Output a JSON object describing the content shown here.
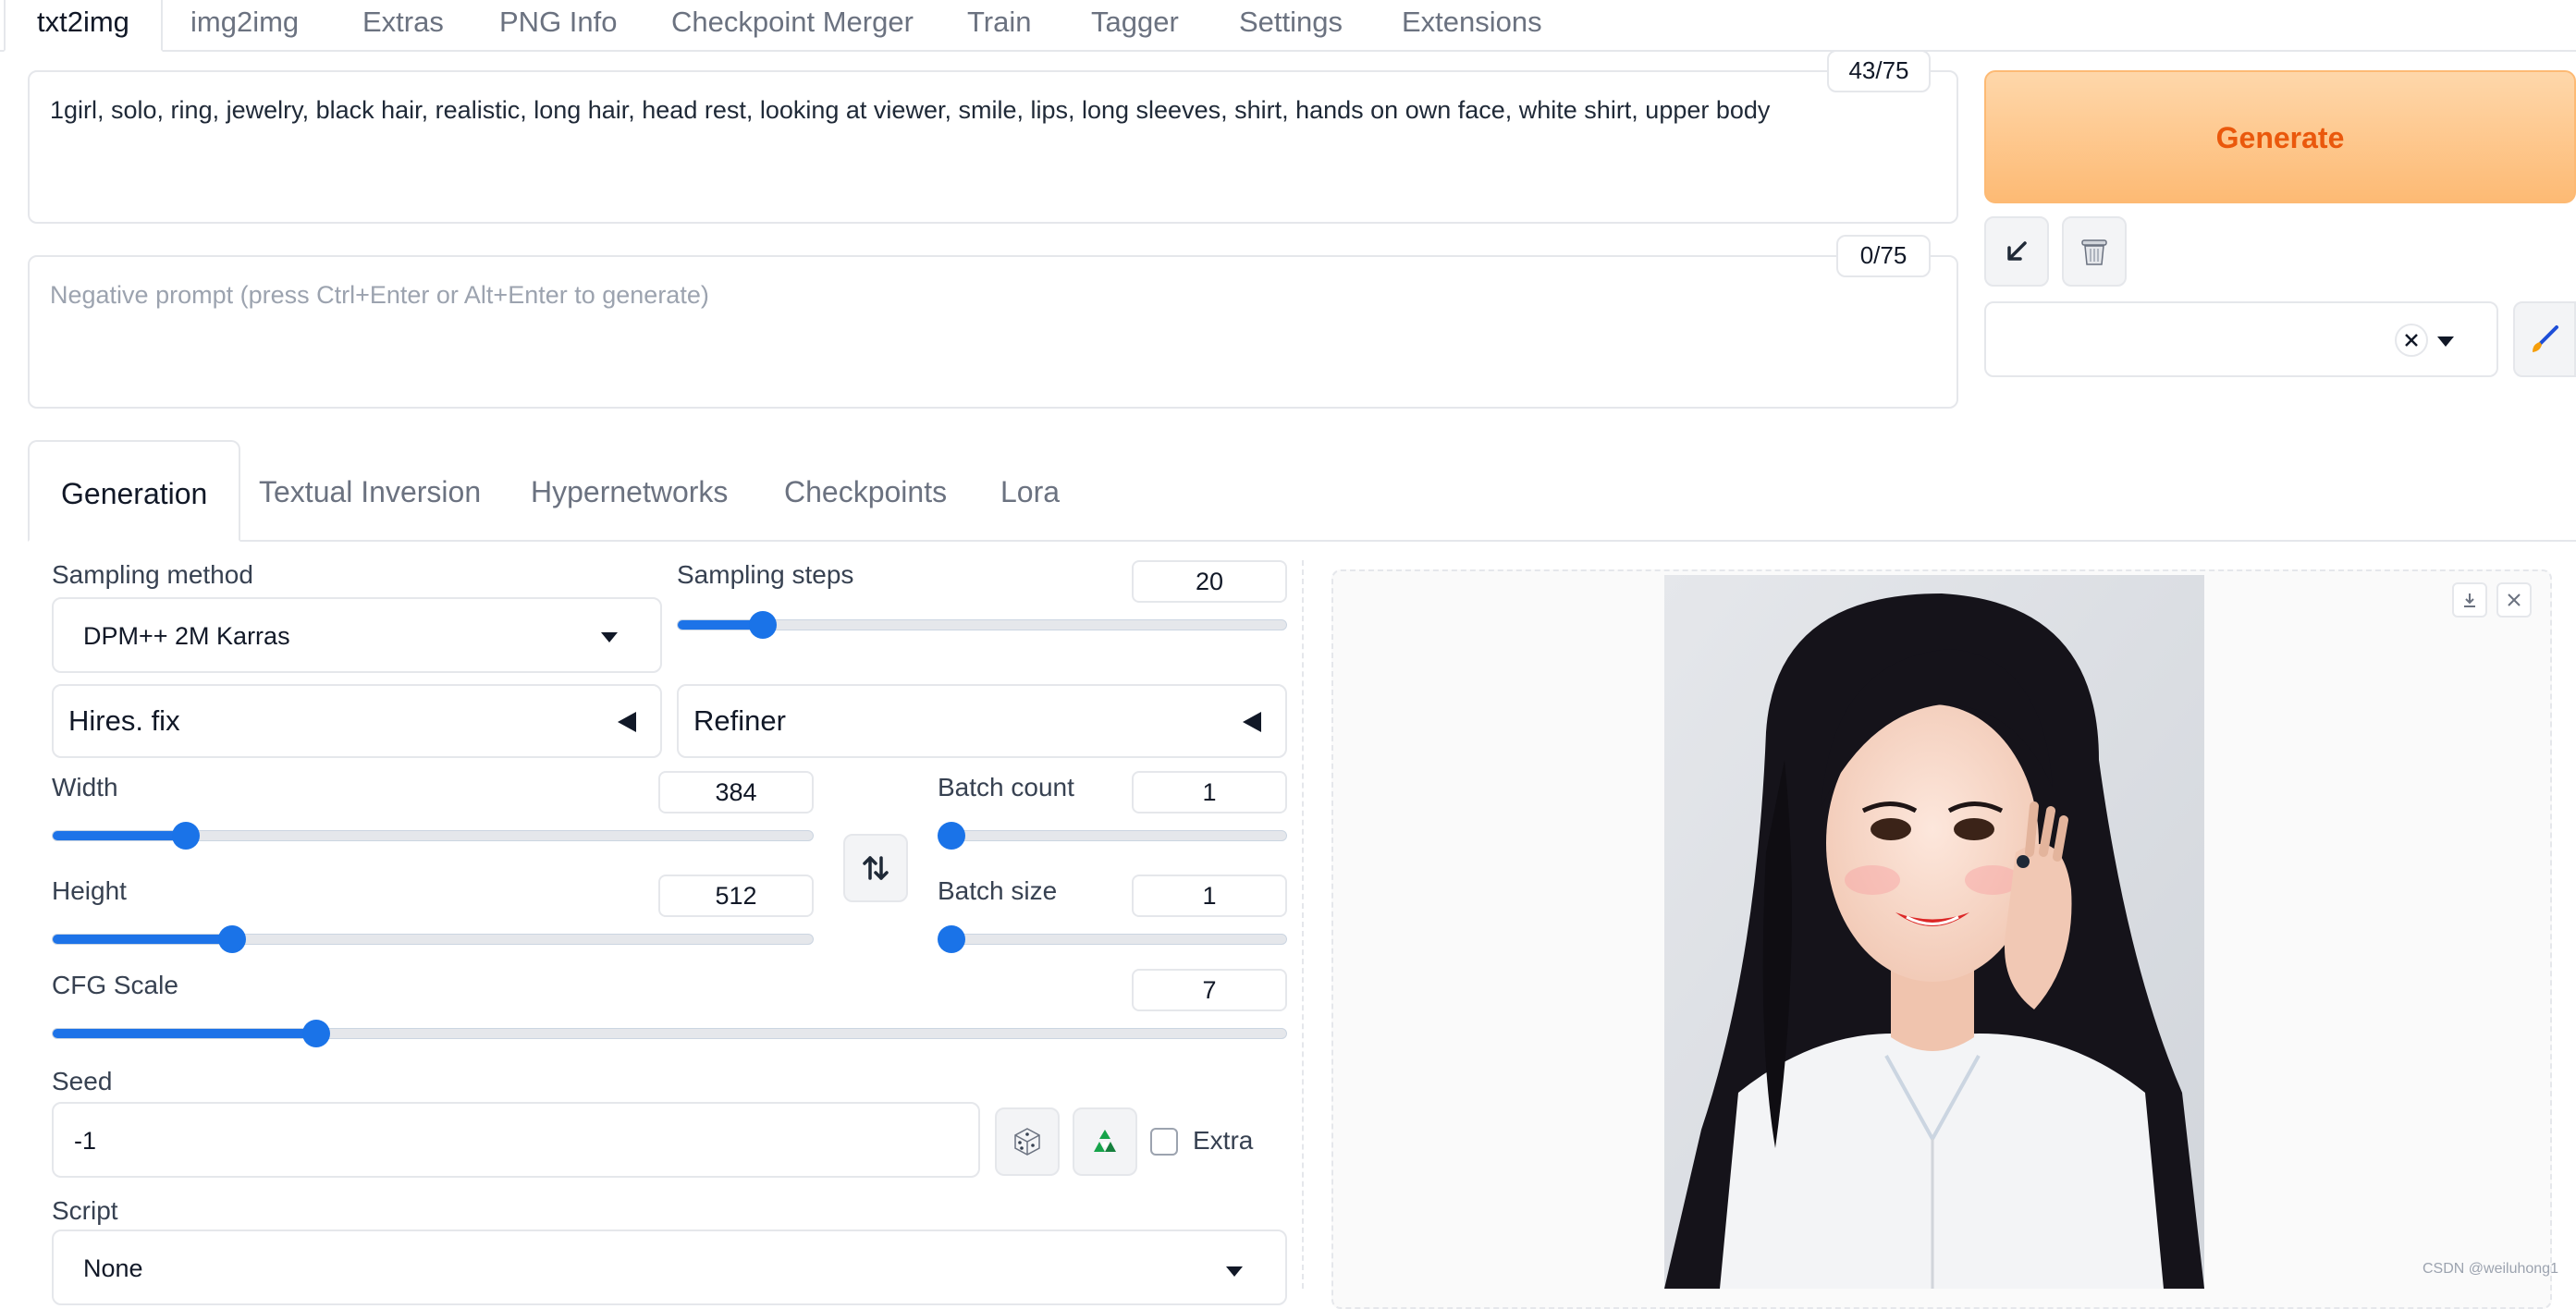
{
  "top_tabs": [
    "txt2img",
    "img2img",
    "Extras",
    "PNG Info",
    "Checkpoint Merger",
    "Train",
    "Tagger",
    "Settings",
    "Extensions"
  ],
  "prompt": {
    "value": "1girl, solo, ring, jewelry, black hair, realistic, long hair, head rest, looking at viewer, smile, lips, long sleeves, shirt, hands on own face, white shirt, upper body",
    "token_count": "43/75"
  },
  "negative_prompt": {
    "placeholder": "Negative prompt (press Ctrl+Enter or Alt+Enter to generate)",
    "token_count": "0/75"
  },
  "generate_label": "Generate",
  "sub_tabs": [
    "Generation",
    "Textual Inversion",
    "Hypernetworks",
    "Checkpoints",
    "Lora"
  ],
  "sampling_method": {
    "label": "Sampling method",
    "value": "DPM++ 2M Karras"
  },
  "sampling_steps": {
    "label": "Sampling steps",
    "value": "20",
    "fraction": 0.14
  },
  "hires_fix_label": "Hires. fix",
  "refiner_label": "Refiner",
  "width": {
    "label": "Width",
    "value": "384",
    "fraction": 0.175
  },
  "height": {
    "label": "Height",
    "value": "512",
    "fraction": 0.236
  },
  "batch_count": {
    "label": "Batch count",
    "value": "1",
    "fraction": 0.0
  },
  "batch_size": {
    "label": "Batch size",
    "value": "1",
    "fraction": 0.0
  },
  "cfg_scale": {
    "label": "CFG Scale",
    "value": "7",
    "fraction": 0.214
  },
  "seed": {
    "label": "Seed",
    "value": "-1",
    "extra_label": "Extra"
  },
  "script": {
    "label": "Script",
    "value": "None"
  },
  "watermark": "CSDN @weiluhong1",
  "colors": {
    "accent": "#1a73e8",
    "generate_text": "#ea580c",
    "generate_bg": "#fdba74"
  },
  "icons": [
    "paste-arrow-icon",
    "trash-icon",
    "clear-x-icon",
    "dropdown-caret-icon",
    "brush-icon",
    "swap-icon",
    "dice-icon",
    "recycle-icon",
    "download-icon",
    "close-icon"
  ]
}
